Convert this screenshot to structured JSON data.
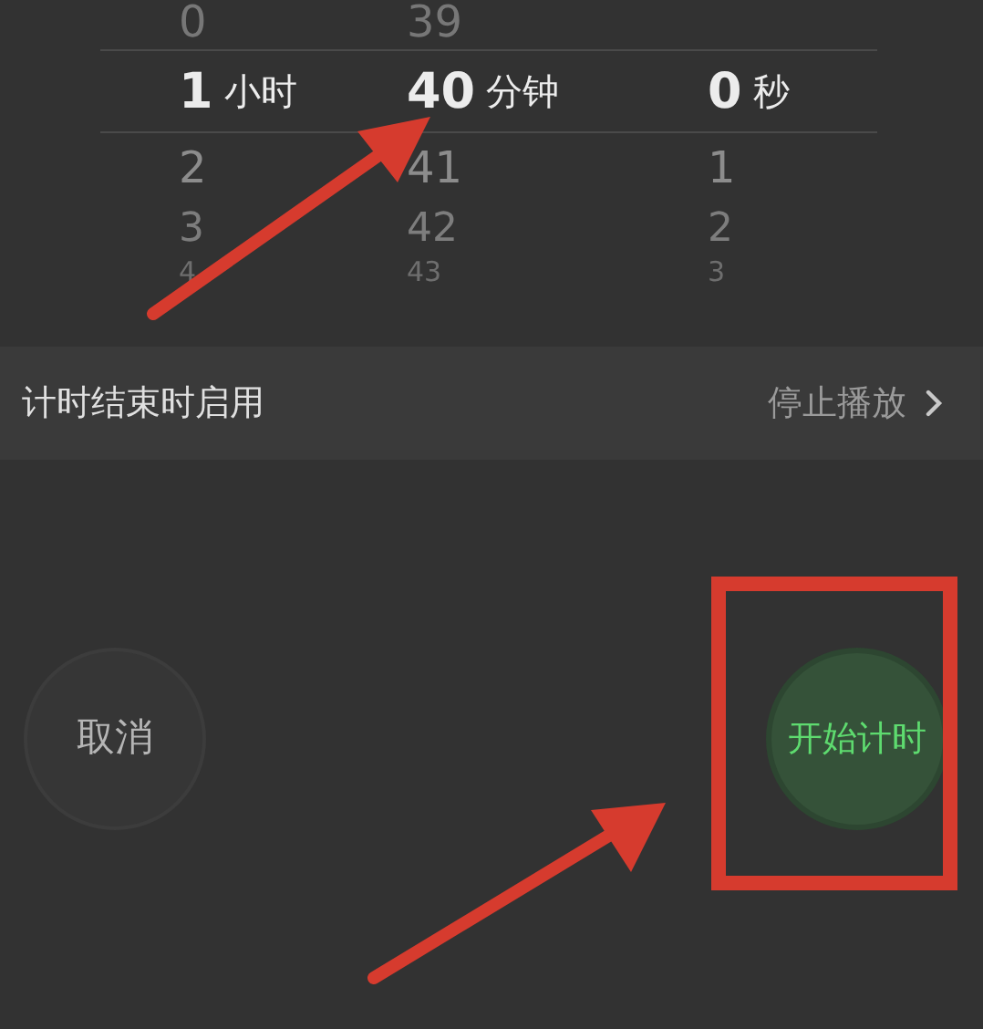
{
  "picker": {
    "columns": [
      {
        "unit": "小时",
        "items": [
          {
            "value": "0",
            "selected": false
          },
          {
            "value": "1",
            "selected": true
          },
          {
            "value": "2",
            "selected": false
          },
          {
            "value": "3",
            "selected": false
          },
          {
            "value": "4",
            "selected": false
          }
        ]
      },
      {
        "unit": "分钟",
        "items": [
          {
            "value": "39",
            "selected": false
          },
          {
            "value": "40",
            "selected": true
          },
          {
            "value": "41",
            "selected": false
          },
          {
            "value": "42",
            "selected": false
          },
          {
            "value": "43",
            "selected": false
          }
        ]
      },
      {
        "unit": "秒",
        "items": [
          {
            "value": "0",
            "selected": true
          },
          {
            "value": "1",
            "selected": false
          },
          {
            "value": "2",
            "selected": false
          },
          {
            "value": "3",
            "selected": false
          }
        ]
      }
    ]
  },
  "setting_row": {
    "label": "计时结束时启用",
    "value": "停止播放"
  },
  "buttons": [
    {
      "kind": "cancel",
      "label": "取消"
    },
    {
      "kind": "start",
      "label": "开始计时"
    }
  ]
}
